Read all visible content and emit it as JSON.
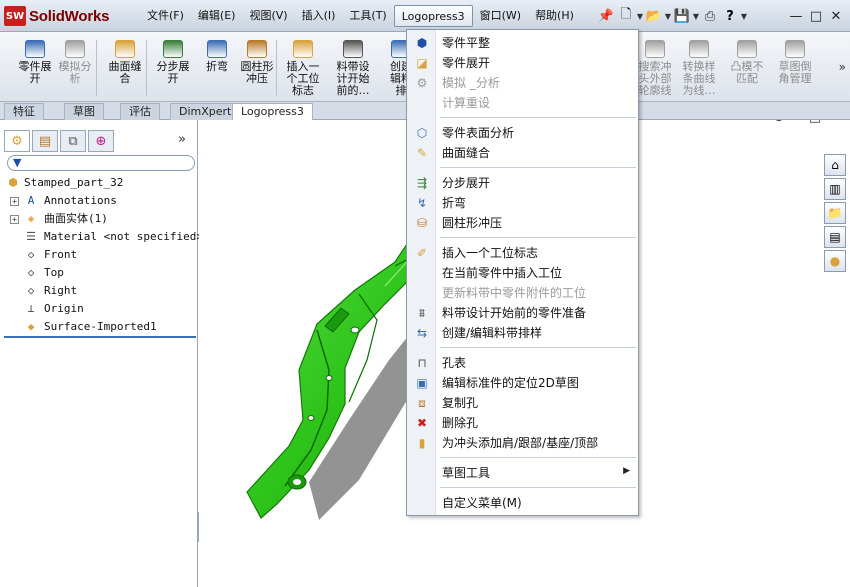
{
  "app": {
    "brand_badge": "SW",
    "brand_name": "SolidWorks"
  },
  "menubar": {
    "items": [
      "文件(F)",
      "编辑(E)",
      "视图(V)",
      "插入(I)",
      "工具(T)",
      "Logopress3",
      "窗口(W)",
      "帮助(H)"
    ],
    "active_index": 5
  },
  "title_tools": {
    "icons": [
      "pin-icon",
      "new-document-icon",
      "open-folder-icon",
      "save-icon",
      "print-icon"
    ],
    "help": "?"
  },
  "window_controls": {
    "minimize": "—",
    "restore": "□",
    "close": "✕"
  },
  "ribbon": {
    "buttons": [
      {
        "label": "零件展\n开",
        "icon": "unfold-part-icon",
        "enabled": true,
        "color": "#3a6db5"
      },
      {
        "label": "模拟分\n析",
        "icon": "simulation-icon",
        "enabled": false,
        "color": "#a0a0a0"
      },
      {
        "label": "曲面缝\n合",
        "icon": "surface-knit-icon",
        "enabled": true,
        "color": "#d9a23b"
      },
      {
        "label": "分步展\n开",
        "icon": "step-unfold-icon",
        "enabled": true,
        "color": "#3a7d3a"
      },
      {
        "label": "折弯",
        "icon": "bend-icon",
        "enabled": true,
        "color": "#3a6db5"
      },
      {
        "label": "圆柱形\n冲压",
        "icon": "cylindrical-punch-icon",
        "enabled": true,
        "color": "#b97a2a"
      },
      {
        "label": "插入一\n个工位\n标志",
        "icon": "insert-station-icon",
        "enabled": true,
        "color": "#d9a23b"
      },
      {
        "label": "料带设\n计开始\n前的…",
        "icon": "strip-prep-icon",
        "enabled": true,
        "color": "#555555"
      },
      {
        "label": "创建\n辑料\n排",
        "icon": "create-strip-icon",
        "enabled": true,
        "color": "#3a6db5"
      },
      {
        "label": "搜索冲\n头外部\n轮廓线",
        "icon": "search-punch-icon",
        "enabled": false,
        "color": "#a0a0a0"
      },
      {
        "label": "转换样\n条曲线\n为线…",
        "icon": "convert-spline-icon",
        "enabled": false,
        "color": "#a0a0a0"
      },
      {
        "label": "凸模不\n匹配",
        "icon": "punch-mismatch-icon",
        "enabled": false,
        "color": "#a0a0a0"
      },
      {
        "label": "草图倒\n角管理",
        "icon": "sketch-chamfer-icon",
        "enabled": false,
        "color": "#a0a0a0"
      }
    ],
    "more": "»"
  },
  "tabs": {
    "items": [
      "特征",
      "草图",
      "评估",
      "DimXpert",
      "Logopress3"
    ],
    "active_index": 4
  },
  "left_panel": {
    "tabs": [
      "feature-manager-icon",
      "property-manager-icon",
      "configuration-manager-icon",
      "dimxpert-manager-icon"
    ],
    "chevron": "»",
    "filter_icon": "filter-icon",
    "tree": [
      {
        "label": "Stamped_part_32",
        "icon": "part-icon",
        "expander": false,
        "indent": 0
      },
      {
        "label": "Annotations",
        "icon": "annotations-icon",
        "expander": true,
        "indent": 1
      },
      {
        "label": "曲面实体(1)",
        "icon": "surface-bodies-icon",
        "expander": true,
        "indent": 1
      },
      {
        "label": "Material <not specified>",
        "icon": "material-icon",
        "expander": false,
        "indent": 1
      },
      {
        "label": "Front",
        "icon": "plane-icon",
        "expander": false,
        "indent": 1
      },
      {
        "label": "Top",
        "icon": "plane-icon",
        "expander": false,
        "indent": 1
      },
      {
        "label": "Right",
        "icon": "plane-icon",
        "expander": false,
        "indent": 1
      },
      {
        "label": "Origin",
        "icon": "origin-icon",
        "expander": false,
        "indent": 1
      },
      {
        "label": "Surface-Imported1",
        "icon": "surface-imported-icon",
        "expander": false,
        "indent": 1
      }
    ]
  },
  "viewport": {
    "part_color": "#2ec41a",
    "controls": [
      "⊗",
      "−",
      "□",
      "✕"
    ],
    "task_pane": [
      "home-icon",
      "design-library-icon",
      "file-explorer-icon",
      "view-palette-icon",
      "appearance-icon"
    ]
  },
  "dropdown": {
    "items": [
      {
        "label": "零件平整",
        "icon": "flatten-part-icon",
        "enabled": true
      },
      {
        "label": "零件展开",
        "icon": "unfold-part-icon",
        "enabled": true
      },
      {
        "label": "模拟 _分析",
        "icon": "simulation-icon",
        "enabled": false
      },
      {
        "label": "计算重设",
        "icon": "",
        "enabled": false
      },
      {
        "sep": true
      },
      {
        "label": "零件表面分析",
        "icon": "surface-analysis-icon",
        "enabled": true
      },
      {
        "label": "曲面缝合",
        "icon": "surface-knit-icon",
        "enabled": true
      },
      {
        "sep": true
      },
      {
        "label": "分步展开",
        "icon": "step-unfold-icon",
        "enabled": true
      },
      {
        "label": "折弯",
        "icon": "bend-icon",
        "enabled": true
      },
      {
        "label": "圆柱形冲压",
        "icon": "cylindrical-punch-icon",
        "enabled": true
      },
      {
        "sep": true
      },
      {
        "label": "插入一个工位标志",
        "icon": "insert-station-icon",
        "enabled": true
      },
      {
        "label": "在当前零件中插入工位",
        "icon": "",
        "enabled": true
      },
      {
        "label": "更新料带中零件附件的工位",
        "icon": "",
        "enabled": false
      },
      {
        "label": "料带设计开始前的零件准备",
        "icon": "strip-prep-icon",
        "enabled": true
      },
      {
        "label": "创建/编辑料带排样",
        "icon": "create-strip-icon",
        "enabled": true
      },
      {
        "sep": true
      },
      {
        "label": "孔表",
        "icon": "hole-table-icon",
        "enabled": true
      },
      {
        "label": "编辑标准件的定位2D草图",
        "icon": "edit-sketch-icon",
        "enabled": true
      },
      {
        "label": "复制孔",
        "icon": "copy-hole-icon",
        "enabled": true
      },
      {
        "label": "删除孔",
        "icon": "delete-hole-icon",
        "enabled": true
      },
      {
        "label": "为冲头添加肩/跟部/基座/顶部",
        "icon": "punch-shoulder-icon",
        "enabled": true
      },
      {
        "sep": true
      },
      {
        "label": "草图工具",
        "icon": "",
        "enabled": true,
        "submenu": true
      },
      {
        "sep": true
      },
      {
        "label": "自定义菜单(M)",
        "icon": "",
        "enabled": true
      }
    ]
  }
}
